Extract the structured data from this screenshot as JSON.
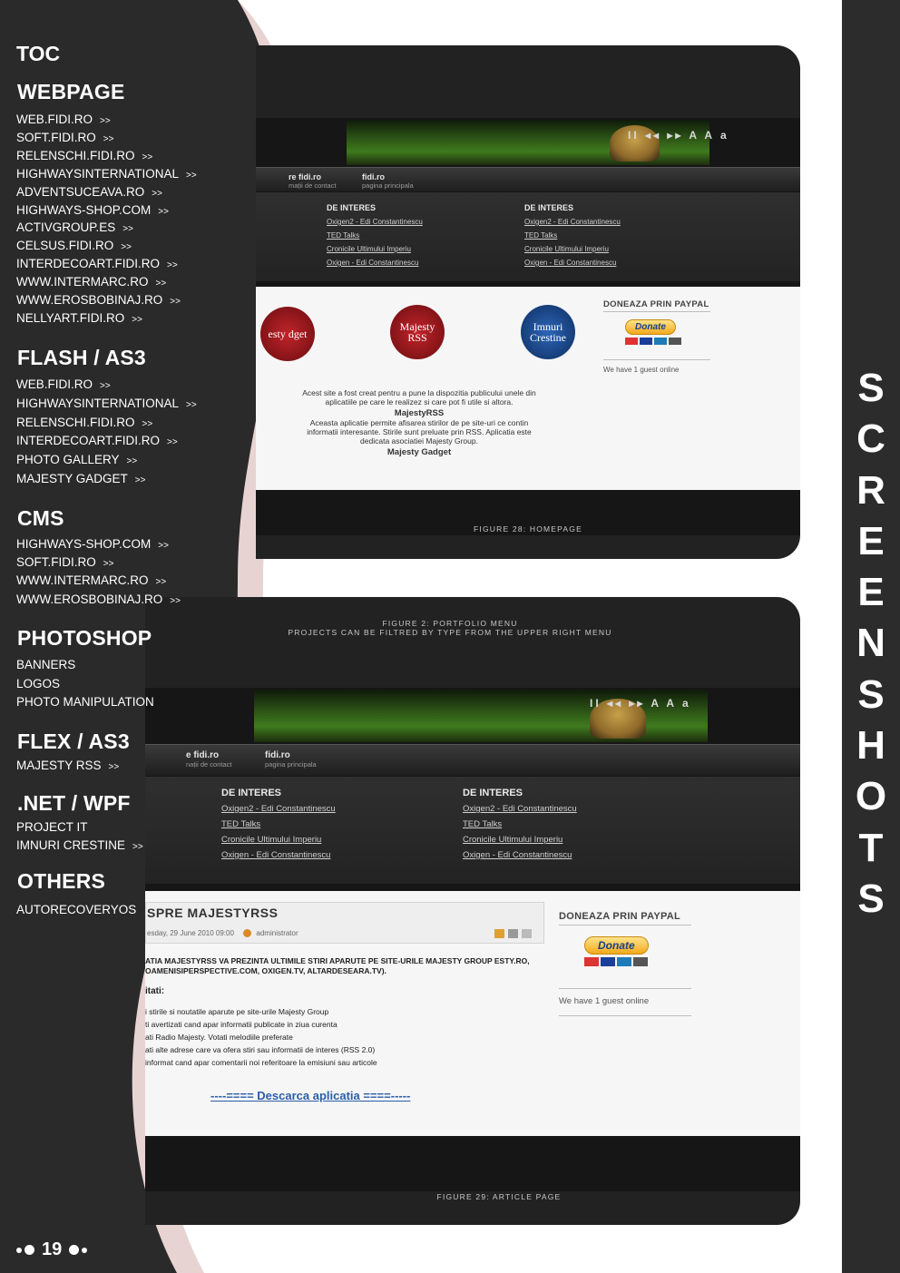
{
  "toc": {
    "title": "TOC",
    "sections": [
      {
        "title": "WEBPAGE",
        "items": [
          "WEB.FIDI.RO",
          "SOFT.FIDI.RO",
          "RELENSCHI.FIDI.RO",
          "HIGHWAYSINTERNATIONAL",
          "ADVENTSUCEAVA.RO",
          "HIGHWAYS-SHOP.COM",
          "ACTIVGROUP.ES",
          "CELSUS.FIDI.RO",
          "INTERDECOART.FIDI.RO",
          "WWW.INTERMARC.RO",
          "WWW.EROSBOBINAJ.RO",
          "NELLYART.FIDI.RO"
        ]
      },
      {
        "title": "FLASH / AS3",
        "items": [
          "WEB.FIDI.RO",
          "HIGHWAYSINTERNATIONAL",
          "RELENSCHI.FIDI.RO",
          "INTERDECOART.FIDI.RO",
          "PHOTO GALLERY",
          "MAJESTY GADGET"
        ]
      },
      {
        "title": "CMS",
        "items": [
          "HIGHWAYS-SHOP.COM",
          "SOFT.FIDI.RO",
          "WWW.INTERMARC.RO",
          "WWW.EROSBOBINAJ.RO"
        ]
      },
      {
        "title": "PHOTOSHOP",
        "items": [
          "BANNERS",
          "LOGOS",
          "PHOTO MANIPULATION"
        ]
      },
      {
        "title": "FLEX / AS3",
        "items": [
          "MAJESTY RSS"
        ]
      },
      {
        "title": ".NET / WPF",
        "items": [
          "PROJECT IT",
          "IMNURI CRESTINE"
        ]
      },
      {
        "title": "OTHERS",
        "items": [
          "AUTORECOVERYOS"
        ]
      }
    ],
    "arrow": ">>"
  },
  "page_number": "19",
  "side_title": [
    "S",
    "C",
    "R",
    "E",
    "E",
    "N",
    "S",
    "H",
    "O",
    "T",
    "S"
  ],
  "figure_home": {
    "caption": "FIGURE 28: HOMEPAGE",
    "player": "II ◂◂ ▸▸   A A a",
    "nav": [
      {
        "title": "re fidi.ro",
        "sub": "mații de contact"
      },
      {
        "title": "fidi.ro",
        "sub": "pagina principala"
      }
    ],
    "interest_cols": [
      {
        "heading": "DE INTERES",
        "links": [
          "Oxigen2 - Edi Constantinescu",
          "TED Talks",
          "Cronicile Ultimului Imperiu",
          "Oxigen - Edi Constantinescu"
        ]
      },
      {
        "heading": "DE INTERES",
        "links": [
          "Oxigen2 - Edi Constantinescu",
          "TED Talks",
          "Cronicile Ultimului Imperiu",
          "Oxigen - Edi Constantinescu"
        ]
      }
    ],
    "badges": [
      "esty dget",
      "Majesty RSS",
      "Imnuri Crestine"
    ],
    "intro": "Acest site a fost creat pentru a pune la dispozitia publicului unele din aplicatiile pe care le realizez si care pot fi utile si altora.",
    "rss_title": "MajestyRSS",
    "rss_text": "Aceasta  aplicatie permite afisarea stirilor de pe site-uri ce contin informatii interesante. Stirile sunt preluate prin RSS. Aplicatia este dedicata asociatiei Majesty Group.",
    "gadget_title": "Majesty Gadget",
    "paypal_heading": "DONEAZA PRIN PAYPAL",
    "donate": "Donate",
    "guest_text": "We have 1 guest online"
  },
  "figure_portfolio": {
    "caption_line1": "FIGURE 2: PORTFOLIO MENU",
    "caption_line2": "PROJECTS CAN BE FILTRED BY TYPE FROM THE UPPER RIGHT MENU"
  },
  "figure_article": {
    "caption": "FIGURE 29: ARTICLE PAGE",
    "player": "II ◂◂ ▸▸   A A a",
    "nav": [
      {
        "title": "e fidi.ro",
        "sub": "nații de contact"
      },
      {
        "title": "fidi.ro",
        "sub": "pagina principala"
      }
    ],
    "interest_cols": [
      {
        "heading": "DE INTERES",
        "links": [
          "Oxigen2 - Edi Constantinescu",
          "TED Talks",
          "Cronicile Ultimului Imperiu",
          "Oxigen - Edi Constantinescu"
        ]
      },
      {
        "heading": "DE INTERES",
        "links": [
          "Oxigen2 - Edi Constantinescu",
          "TED Talks",
          "Cronicile Ultimului Imperiu",
          "Oxigen - Edi Constantinescu"
        ]
      }
    ],
    "article_title": "SPRE MAJESTYRSS",
    "meta_date": "esday, 29 June 2010 09:00",
    "meta_author": "administrator",
    "intro_bold": "ATIA MAJESTYRSS VA PREZINTA ULTIMILE STIRI APARUTE PE SITE-URILE MAJESTY GROUP ESTY.RO, OAMENISIPERSPECTIVE.COM, OXIGEN.TV, ALTARDESEARA.TV).",
    "features_heading": "itati:",
    "features": [
      "i stirile si noutatile aparute pe site-urile Majesty Group",
      "ti avertizati cand apar informatii publicate in ziua curenta",
      "ati Radio Majesty. Votati melodiile preferate",
      "ati alte adrese care va ofera stiri sau informatii de interes (RSS 2.0)",
      "informat cand apar comentarii noi referitoare la emisiuni sau articole"
    ],
    "download": "----==== Descarca aplicatia ====-----",
    "paypal_heading": "DONEAZA PRIN PAYPAL",
    "donate": "Donate",
    "guest_text": "We have 1 guest online"
  },
  "colors": {
    "sidebar": "#2a2a2a",
    "curve_pink": "#e8d3d3",
    "right_strip": "#2c2c2c",
    "panel": "#222222"
  }
}
